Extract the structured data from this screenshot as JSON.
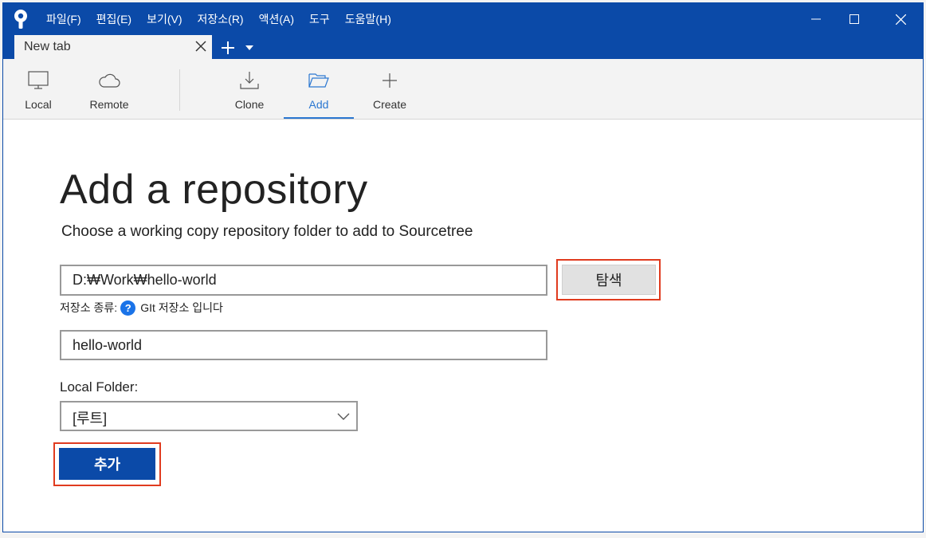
{
  "menu": [
    "파일(F)",
    "편집(E)",
    "보기(V)",
    "저장소(R)",
    "액션(A)",
    "도구",
    "도움말(H)"
  ],
  "tab": {
    "title": "New tab"
  },
  "toolbar": {
    "local": "Local",
    "remote": "Remote",
    "clone": "Clone",
    "add": "Add",
    "create": "Create",
    "active": "Add"
  },
  "form": {
    "heading": "Add a repository",
    "subheading": "Choose a working copy repository folder to add to Sourcetree",
    "path_value": "D:₩Work₩hello-world",
    "browse_label": "탐색",
    "repo_type_prefix": "저장소 종류:",
    "repo_type_text": "GIt 저장소 입니다",
    "name_value": "hello-world",
    "local_folder_label": "Local Folder:",
    "local_folder_value": "[루트]",
    "add_label": "추가"
  },
  "colors": {
    "brand": "#0b4aa8",
    "accent": "#2b77d1",
    "highlight": "#e03b1f"
  }
}
